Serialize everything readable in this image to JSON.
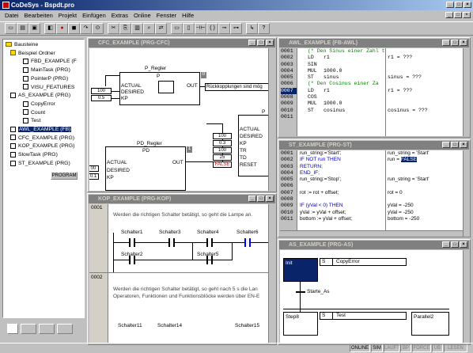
{
  "app": {
    "title": "CoDeSys - Bspdt.pro"
  },
  "menu": [
    "Datei",
    "Bearbeiten",
    "Projekt",
    "Einfügen",
    "Extras",
    "Online",
    "Fenster",
    "Hilfe"
  ],
  "tree": {
    "root": "Bausteine",
    "items": [
      "Beispiel Ordner",
      "FBD_EXAMPLE (F",
      "MainTask (PRG)",
      "PointerP (PRG)",
      "VISU_FEATURES",
      "AS_EXAMPLE (PRG)",
      "CopyError",
      "Count",
      "Test",
      "AWL_EXAMPLE (FB)",
      "CFC_EXAMPLE (PRG)",
      "KOP_EXAMPLE (PRG)",
      "SlowTask (PRG)",
      "ST_EXAMPLE (PRG)"
    ],
    "selected_label": "PROGRAM"
  },
  "cfc": {
    "title": "CFC_EXAMPLE (PRG-CFC)",
    "block1": {
      "name": "P_Regler",
      "type": "P",
      "inputs": [
        "ACTUAL",
        "DESIRED",
        "KP"
      ],
      "output": "OUT",
      "const_desired": "100",
      "const_kp": "0.5"
    },
    "comment": "Rückkopplungen sind mög",
    "block2": {
      "name": "PD_Regler",
      "type": "PD",
      "inputs": [
        "ACTUAL",
        "DESIRED",
        "KP"
      ],
      "output": "OUT",
      "const_desired": "00",
      "const_kp": "0.1",
      "badge": "1"
    },
    "block3": {
      "name": "P",
      "inputs": [
        "ACTUAL",
        "DESIRED",
        "KP",
        "TR",
        "TD",
        "RESET"
      ],
      "consts": [
        "100",
        "0.3",
        "100",
        "25",
        "FALSE"
      ]
    }
  },
  "awl": {
    "title": "AWL_EXAMPLE (FB-AWL)",
    "lines": [
      "0001",
      "0002",
      "0003",
      "0004",
      "0005",
      "0006",
      "0007",
      "0008",
      "0009",
      "0010",
      "0011"
    ],
    "code": [
      {
        "op": "",
        "arg": "(* Den Sinus einer Zahl t",
        "cmt": true
      },
      {
        "op": "LD",
        "arg": "r1",
        "cmt": false
      },
      {
        "op": "SIN",
        "arg": "",
        "cmt": false
      },
      {
        "op": "MUL",
        "arg": "1000.0",
        "cmt": false
      },
      {
        "op": "ST",
        "arg": "sinus",
        "cmt": false
      },
      {
        "op": "",
        "arg": "(* Den Cosinus  einer Za",
        "cmt": true
      },
      {
        "op": "LD",
        "arg": "r1",
        "cmt": false
      },
      {
        "op": "COS",
        "arg": "",
        "cmt": false
      },
      {
        "op": "MUL",
        "arg": "1000.0",
        "cmt": false
      },
      {
        "op": "ST",
        "arg": "cosinus",
        "cmt": false
      },
      {
        "op": "",
        "arg": "",
        "cmt": false
      }
    ],
    "watch": [
      "",
      "r1 = ???",
      "",
      "",
      "sinus = ???",
      "",
      "r1 = ???",
      "",
      "",
      "cosinus = ???",
      ""
    ]
  },
  "st": {
    "title": "ST_EXAMPLE (PRG-ST)",
    "lines": [
      "0001",
      "0002",
      "0003",
      "0004",
      "0005",
      "0006",
      "0007",
      "0008",
      "0009",
      "0010",
      "0011"
    ],
    "code": [
      "run_string:='Start';",
      "IF NOT run THEN",
      "    RETURN;",
      "END_IF;",
      "run_string:='Stop';",
      "",
      "rot := rot + offset;",
      "",
      "IF (yVal < 0) THEN",
      "    yVal := yVal + offset;",
      "    bottom := yVal + offset;"
    ],
    "watch": [
      "run_string = 'Start'",
      "run = ",
      "",
      "",
      "run_string = 'Start'",
      "",
      "rot = 0",
      "",
      "yVal = -250",
      "yVal = -250",
      "bottom = -250"
    ],
    "watch_highlight": "FALSE"
  },
  "kop": {
    "title": "KOP_EXAMPLE (PRG-KOP)",
    "net1": "0001",
    "net1_comment": "Werden die richtigen Schalter betätigt, so geht die Lampe an.",
    "contacts1": [
      "Schalter1",
      "Schalter3",
      "Schalter4",
      "Schalter6",
      "Schalter2",
      "Schalter5"
    ],
    "net2": "0002",
    "net2_comment": "Werden die richtigen Schalter betätigt, so geht nach 5 s die Lan",
    "net2_comment2": "Operatoren, Funktionen und Funktionsblöcke werden über EN-E",
    "contacts2": [
      "Schalter11",
      "Schalter14",
      "Schalter15"
    ]
  },
  "as": {
    "title": "AS_EXAMPLE (PRG-AS)",
    "init": "Init",
    "init_action": "CopyError",
    "init_q": "S",
    "transition": "Starte_As",
    "step": "Step8",
    "step_action": "Test",
    "step_q": "S",
    "parallel": "Parallel2"
  },
  "status": [
    "ONLINE",
    "SIM",
    "LAUFT",
    "BP",
    "FORCE",
    "UB",
    "LESEN"
  ]
}
